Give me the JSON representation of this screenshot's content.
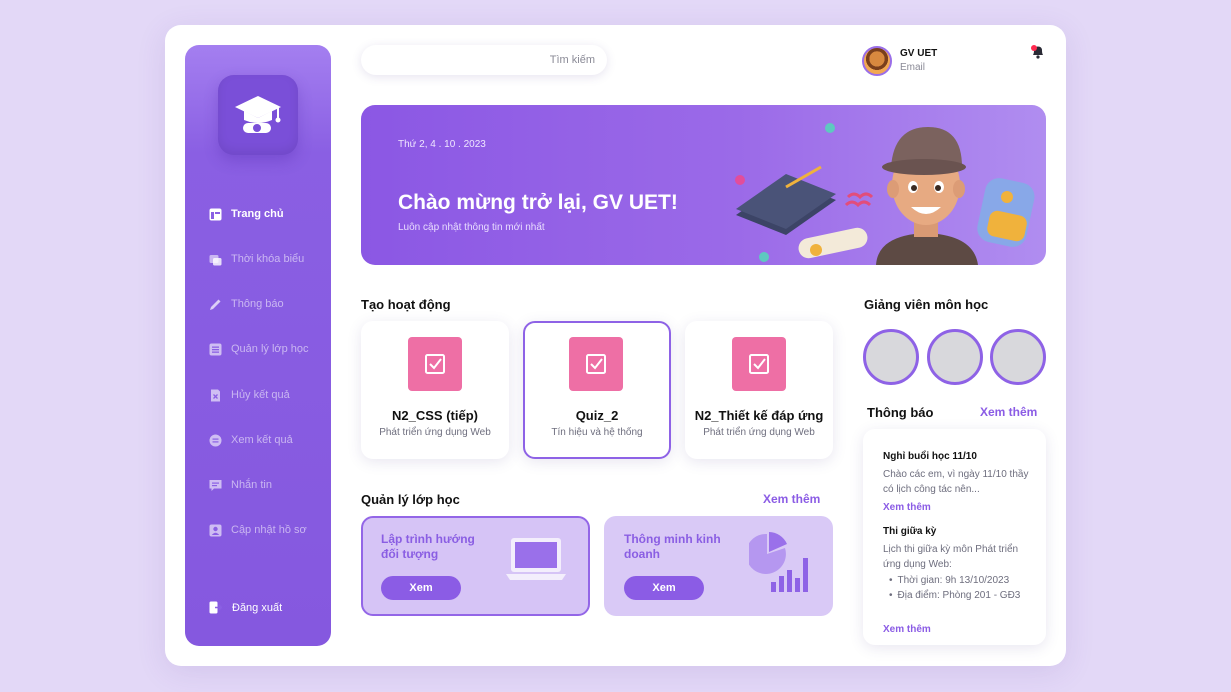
{
  "sidebar": {
    "items": [
      {
        "label": "Trang chủ",
        "icon": "home-icon"
      },
      {
        "label": "Thời khóa biểu",
        "icon": "schedule-icon"
      },
      {
        "label": "Thông báo",
        "icon": "pencil-icon"
      },
      {
        "label": "Quản lý lớp học",
        "icon": "list-icon"
      },
      {
        "label": "Hủy kết quả",
        "icon": "cancel-file-icon"
      },
      {
        "label": "Xem kết quả",
        "icon": "results-icon"
      },
      {
        "label": "Nhắn tin",
        "icon": "chat-icon"
      },
      {
        "label": "Cập nhật hồ sơ",
        "icon": "profile-icon"
      }
    ],
    "logout_label": "Đăng xuất"
  },
  "header": {
    "search_placeholder": "Tìm kiếm",
    "user_name": "GV UET",
    "user_email": "Email"
  },
  "banner": {
    "date": "Thứ 2, 4 . 10 . 2023",
    "title": "Chào mừng trở lại, GV UET!",
    "subtitle": "Luôn cập nhật thông tin mới nhất"
  },
  "activities": {
    "title": "Tạo hoạt động",
    "cards": [
      {
        "name": "N2_CSS (tiếp)",
        "desc": "Phát triển ứng dụng Web"
      },
      {
        "name": "Quiz_2",
        "desc": "Tín hiệu và hệ thống"
      },
      {
        "name": "N2_Thiết kế đáp ứng",
        "desc": "Phát triển ứng dụng Web"
      }
    ]
  },
  "classes": {
    "title": "Quản lý lớp học",
    "see_more": "Xem thêm",
    "cards": [
      {
        "title": "Lập trình hướng đối tượng",
        "button": "Xem"
      },
      {
        "title": "Thông minh kinh doanh",
        "button": "Xem"
      }
    ]
  },
  "lecturers": {
    "title": "Giảng viên môn học"
  },
  "notifications": {
    "title": "Thông báo",
    "see_more": "Xem thêm",
    "items": [
      {
        "title": "Nghỉ buổi học 11/10",
        "body": "Chào các em, vì ngày 11/10 thầy có lịch công tác nên...",
        "more": "Xem thêm"
      },
      {
        "title": "Thi giữa kỳ",
        "body": "Lịch thi giữa kỳ môn Phát triển ứng dụng Web:",
        "bullets": [
          "Thời gian: 9h 13/10/2023",
          "Địa điểm: Phòng 201 - GĐ3"
        ],
        "more": "Xem thêm"
      }
    ]
  },
  "colors": {
    "primary": "#8b5ce5",
    "accent_pink": "#ee6fa5",
    "background": "#e3d8f7"
  }
}
